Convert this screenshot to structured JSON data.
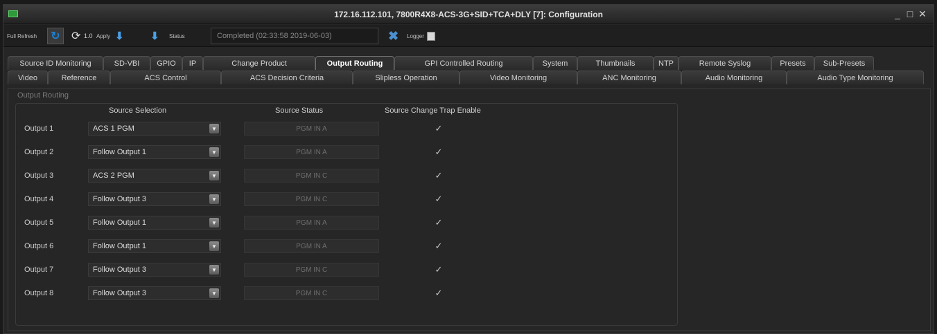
{
  "window": {
    "title": "172.16.112.101, 7800R4X8-ACS-3G+SID+TCA+DLY  [7]: Configuration",
    "controls": [
      "_",
      "□",
      "✕"
    ]
  },
  "toolbar": {
    "full_refresh_label": "Full Refresh",
    "refresh_icon": "refresh-icon",
    "cycle_value": "1.0",
    "apply_label": "Apply",
    "status_label": "Status",
    "status_value": "Completed  (02:33:58 2019-06-03)",
    "logger_label": "Logger"
  },
  "tabs_row1": [
    {
      "label": "Source ID Monitoring"
    },
    {
      "label": "SD-VBI"
    },
    {
      "label": "GPIO"
    },
    {
      "label": "IP"
    },
    {
      "label": "Change Product"
    },
    {
      "label": "Output Routing"
    },
    {
      "label": "GPI Controlled Routing"
    },
    {
      "label": "System"
    },
    {
      "label": "Thumbnails"
    },
    {
      "label": "NTP"
    },
    {
      "label": "Remote Syslog"
    },
    {
      "label": "Presets"
    },
    {
      "label": "Sub-Presets"
    }
  ],
  "tabs_row2": [
    {
      "label": "Video"
    },
    {
      "label": "Reference"
    },
    {
      "label": "ACS Control"
    },
    {
      "label": "ACS Decision Criteria"
    },
    {
      "label": "Slipless Operation"
    },
    {
      "label": "Video Monitoring"
    },
    {
      "label": "ANC Monitoring"
    },
    {
      "label": "Audio Monitoring"
    },
    {
      "label": "Audio Type Monitoring"
    }
  ],
  "active_tab": "Output Routing",
  "group": {
    "title": "Output Routing",
    "col_source_selection": "Source Selection",
    "col_source_status": "Source Status",
    "col_trap_enable": "Source Change Trap Enable",
    "rows": [
      {
        "label": "Output 1",
        "selection": "ACS 1 PGM",
        "status": "PGM IN A",
        "trap": true
      },
      {
        "label": "Output 2",
        "selection": "Follow Output 1",
        "status": "PGM IN A",
        "trap": true
      },
      {
        "label": "Output 3",
        "selection": "ACS 2 PGM",
        "status": "PGM IN C",
        "trap": true
      },
      {
        "label": "Output 4",
        "selection": "Follow Output 3",
        "status": "PGM IN C",
        "trap": true
      },
      {
        "label": "Output 5",
        "selection": "Follow Output 1",
        "status": "PGM IN A",
        "trap": true
      },
      {
        "label": "Output 6",
        "selection": "Follow Output 1",
        "status": "PGM IN A",
        "trap": true
      },
      {
        "label": "Output 7",
        "selection": "Follow Output 3",
        "status": "PGM IN C",
        "trap": true
      },
      {
        "label": "Output 8",
        "selection": "Follow Output 3",
        "status": "PGM IN C",
        "trap": true
      }
    ]
  },
  "colors": {
    "accent_blue": "#4aa0e6",
    "window_bg": "#262626",
    "titlebar_text": "#e2e2e2"
  }
}
